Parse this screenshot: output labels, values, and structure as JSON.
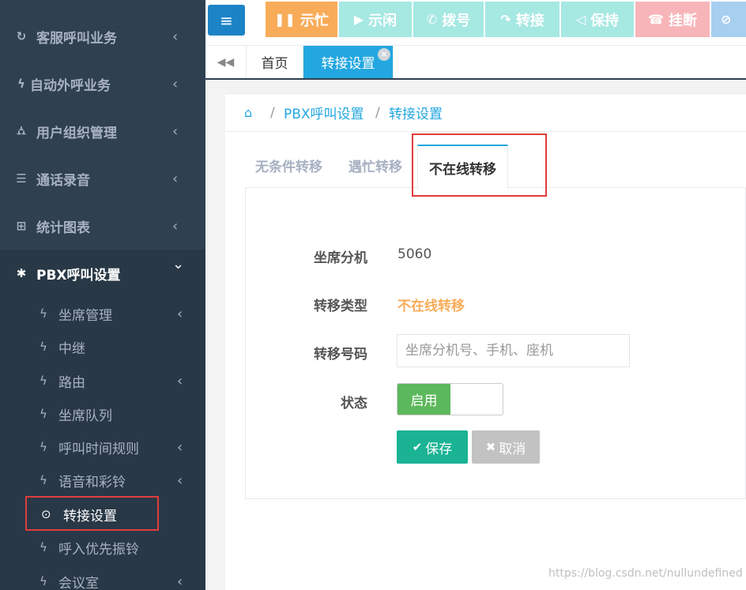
{
  "sidebar": {
    "menu": [
      {
        "icon": "refresh-icon",
        "glyph": "↻",
        "label": "客服呼叫业务",
        "chevron": "‹"
      },
      {
        "icon": "bolt-icon",
        "glyph": "ϟ",
        "label": "自动外呼业务",
        "chevron": "‹"
      },
      {
        "icon": "sitemap-icon",
        "glyph": "⛼",
        "label": "用户组织管理",
        "chevron": "‹"
      },
      {
        "icon": "list-icon",
        "glyph": "☰",
        "label": "通话录音",
        "chevron": "‹"
      },
      {
        "icon": "table-icon",
        "glyph": "⊞",
        "label": "统计图表",
        "chevron": "‹"
      },
      {
        "icon": "asterisk-icon",
        "glyph": "✱",
        "label": "PBX呼叫设置",
        "chevron": "⌄"
      }
    ],
    "submenu": [
      {
        "label": "坐席管理",
        "glyph": "ϟ",
        "chevron": "‹"
      },
      {
        "label": "中继",
        "glyph": "ϟ",
        "chevron": ""
      },
      {
        "label": "路由",
        "glyph": "ϟ",
        "chevron": "‹"
      },
      {
        "label": "坐席队列",
        "glyph": "ϟ",
        "chevron": ""
      },
      {
        "label": "呼叫时间规则",
        "glyph": "ϟ",
        "chevron": "‹"
      },
      {
        "label": "语音和彩铃",
        "glyph": "ϟ",
        "chevron": "‹"
      },
      {
        "label": "转接设置",
        "glyph": "⊙",
        "chevron": ""
      },
      {
        "label": "呼入优先振铃",
        "glyph": "ϟ",
        "chevron": ""
      },
      {
        "label": "会议室",
        "glyph": "ϟ",
        "chevron": "‹"
      }
    ]
  },
  "toolbar": {
    "menu_glyph": "≡",
    "buttons": [
      {
        "label": "示忙",
        "glyph": "❚❚",
        "color": "#f8ac59"
      },
      {
        "label": "示闲",
        "glyph": "▶",
        "color": "#a6e8e2"
      },
      {
        "label": "拨号",
        "glyph": "✆",
        "color": "#a6e8e2"
      },
      {
        "label": "转接",
        "glyph": "↷",
        "color": "#a6e8e2"
      },
      {
        "label": "保持",
        "glyph": "◁",
        "color": "#a6e8e2"
      },
      {
        "label": "挂断",
        "glyph": "☎",
        "color": "#f7b5b9"
      },
      {
        "label": "",
        "glyph": "⊘",
        "color": "#a7cff0"
      }
    ]
  },
  "tabs": {
    "back_glyph": "◀◀",
    "items": [
      {
        "label": "首页"
      },
      {
        "label": "转接设置",
        "close": "×"
      }
    ]
  },
  "breadcrumb": {
    "home_glyph": "⌂",
    "sep": "/",
    "items": [
      "PBX呼叫设置",
      "转接设置"
    ]
  },
  "inner_tabs": [
    "无条件转移",
    "遇忙转移",
    "不在线转移"
  ],
  "form": {
    "agent_ext_label": "坐席分机",
    "agent_ext_value": "5060",
    "transfer_type_label": "转移类型",
    "transfer_type_value": "不在线转移",
    "transfer_number_label": "转移号码",
    "transfer_number_placeholder": "坐席分机号、手机、座机",
    "status_label": "状态",
    "status_on": "启用",
    "save_label": "保存",
    "save_glyph": "✔",
    "cancel_label": "取消",
    "cancel_glyph": "✖"
  },
  "watermark": "https://blog.csdn.net/nullundefined",
  "colors": {
    "sidebar_bg": "#2f4050",
    "accent_blue": "#23a7e0",
    "save_green": "#1ab394",
    "cancel_gray": "#c2c2c2",
    "toggle_green": "#5cb85c",
    "highlight_red": "#e03c3c"
  }
}
